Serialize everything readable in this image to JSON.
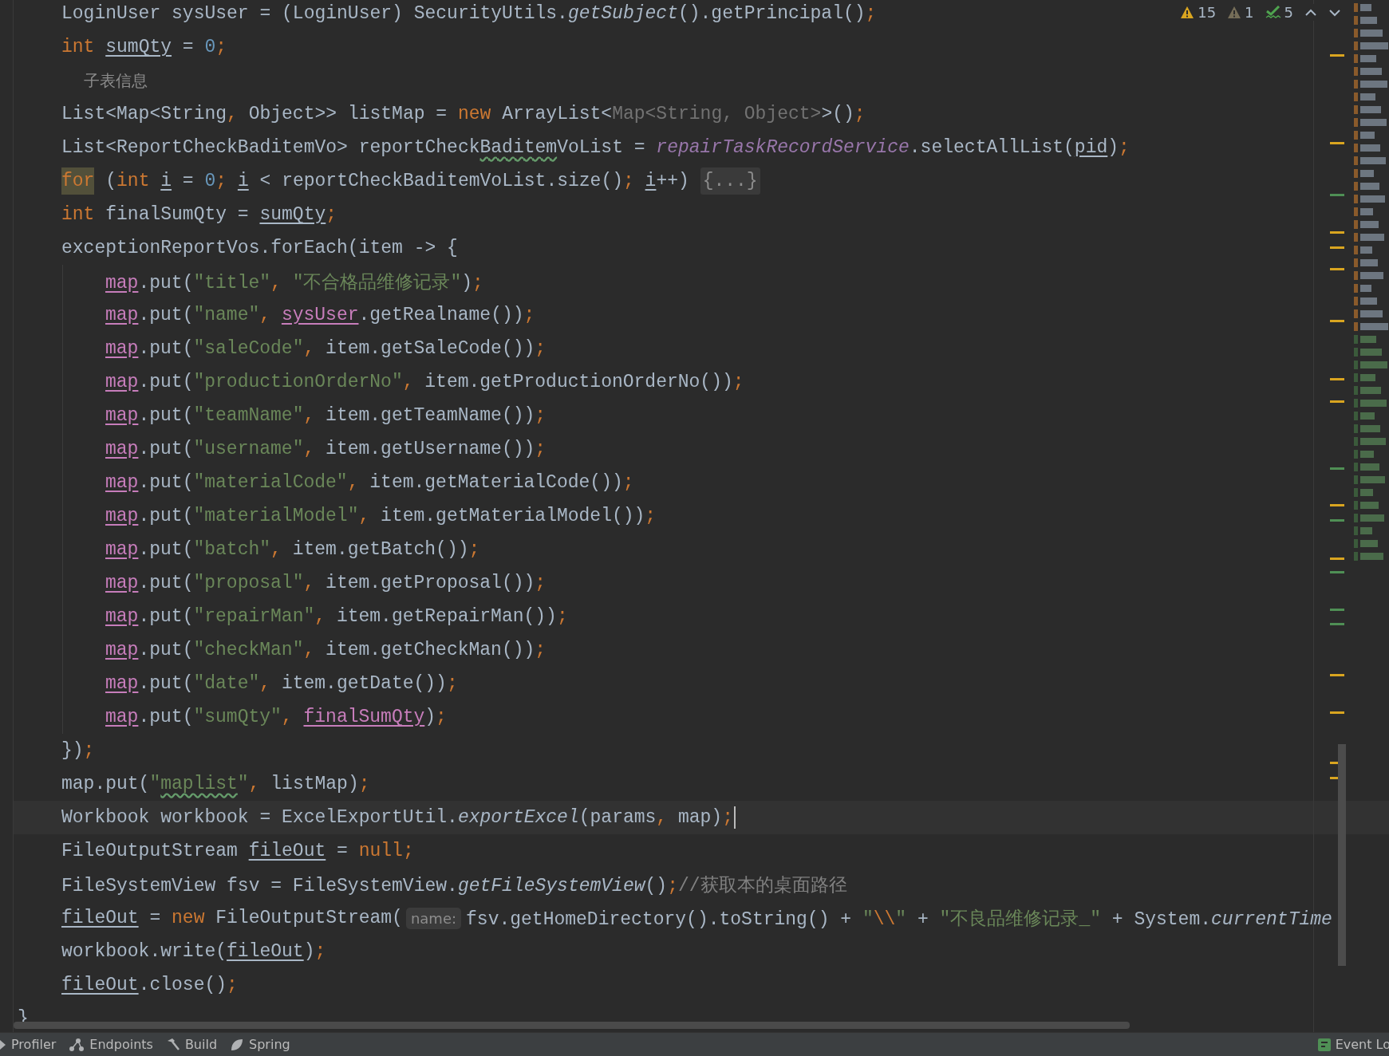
{
  "editor": {
    "inspections": [
      {
        "kind": "warning",
        "count": "15"
      },
      {
        "kind": "weak_warning",
        "count": "1"
      },
      {
        "kind": "typo",
        "count": "5"
      }
    ],
    "body": [
      {
        "current": false,
        "tokens": [
          {
            "kind": "plain",
            "text": "LoginUser sysUser = (LoginUser) SecurityUtils."
          },
          {
            "kind": "italic",
            "text": "getSubject"
          },
          {
            "kind": "plain",
            "text": "().getPrincipal()"
          },
          {
            "kind": "kw",
            "text": ";"
          }
        ]
      },
      {
        "current": false,
        "tokens": [
          {
            "kind": "kw",
            "text": "int "
          },
          {
            "kind": "local",
            "text": "sumQty"
          },
          {
            "kind": "plain",
            "text": " = "
          },
          {
            "kind": "num",
            "text": "0"
          },
          {
            "kind": "kw",
            "text": ";"
          }
        ]
      },
      {
        "current": false,
        "tokens": [
          {
            "kind": "doc",
            "text": "子表信息"
          }
        ]
      },
      {
        "current": false,
        "tokens": [
          {
            "kind": "plain",
            "text": "List<Map<String"
          },
          {
            "kind": "kw",
            "text": ", "
          },
          {
            "kind": "plain",
            "text": "Object>> listMap = "
          },
          {
            "kind": "kw",
            "text": "new "
          },
          {
            "kind": "plain",
            "text": "ArrayList<"
          },
          {
            "kind": "muted",
            "text": "Map<String, Object>"
          },
          {
            "kind": "plain",
            "text": ">()"
          },
          {
            "kind": "kw",
            "text": ";"
          }
        ]
      },
      {
        "current": false,
        "tokens": [
          {
            "kind": "plain",
            "text": "List<ReportCheckBaditemVo> reportCheck"
          },
          {
            "kind": "typo",
            "text": "Baditem"
          },
          {
            "kind": "plain",
            "text": "VoList = "
          },
          {
            "kind": "static",
            "text": "repairTaskRecordService"
          },
          {
            "kind": "plain",
            "text": ".selectAllList("
          },
          {
            "kind": "local",
            "text": "pid"
          },
          {
            "kind": "plain",
            "text": ")"
          },
          {
            "kind": "kw",
            "text": ";"
          }
        ]
      },
      {
        "current": false,
        "tokens": [
          {
            "kind": "mark",
            "text": "for"
          },
          {
            "kind": "plain",
            "text": " ("
          },
          {
            "kind": "kw",
            "text": "int "
          },
          {
            "kind": "local",
            "text": "i"
          },
          {
            "kind": "plain",
            "text": " = "
          },
          {
            "kind": "num",
            "text": "0"
          },
          {
            "kind": "kw",
            "text": "; "
          },
          {
            "kind": "local",
            "text": "i"
          },
          {
            "kind": "plain",
            "text": " < reportCheckBaditemVoList.size()"
          },
          {
            "kind": "kw",
            "text": "; "
          },
          {
            "kind": "local",
            "text": "i"
          },
          {
            "kind": "plain",
            "text": "++) "
          },
          {
            "kind": "fold",
            "text": "{...}"
          }
        ]
      },
      {
        "current": false,
        "tokens": [
          {
            "kind": "kw",
            "text": "int "
          },
          {
            "kind": "plain",
            "text": "finalSumQty = "
          },
          {
            "kind": "local",
            "text": "sumQty"
          },
          {
            "kind": "kw",
            "text": ";"
          }
        ]
      },
      {
        "current": false,
        "tokens": [
          {
            "kind": "plain",
            "text": "exceptionReportVos.forEach(item -> {"
          }
        ],
        "children": [
          {
            "current": false,
            "tokens": [
              {
                "kind": "captured",
                "text": "map"
              },
              {
                "kind": "plain",
                "text": ".put("
              },
              {
                "kind": "str",
                "text": "\"title\""
              },
              {
                "kind": "kw",
                "text": ", "
              },
              {
                "kind": "str",
                "text": "\"不合格品维修记录\""
              },
              {
                "kind": "plain",
                "text": ")"
              },
              {
                "kind": "kw",
                "text": ";"
              }
            ]
          },
          {
            "current": false,
            "tokens": [
              {
                "kind": "captured",
                "text": "map"
              },
              {
                "kind": "plain",
                "text": ".put("
              },
              {
                "kind": "str",
                "text": "\"name\""
              },
              {
                "kind": "kw",
                "text": ", "
              },
              {
                "kind": "captured",
                "text": "sysUser"
              },
              {
                "kind": "plain",
                "text": ".getRealname())"
              },
              {
                "kind": "kw",
                "text": ";"
              }
            ]
          },
          {
            "current": false,
            "tokens": [
              {
                "kind": "captured",
                "text": "map"
              },
              {
                "kind": "plain",
                "text": ".put("
              },
              {
                "kind": "str",
                "text": "\"saleCode\""
              },
              {
                "kind": "kw",
                "text": ", "
              },
              {
                "kind": "plain",
                "text": "item.getSaleCode())"
              },
              {
                "kind": "kw",
                "text": ";"
              }
            ]
          },
          {
            "current": false,
            "tokens": [
              {
                "kind": "captured",
                "text": "map"
              },
              {
                "kind": "plain",
                "text": ".put("
              },
              {
                "kind": "str",
                "text": "\"productionOrderNo\""
              },
              {
                "kind": "kw",
                "text": ", "
              },
              {
                "kind": "plain",
                "text": "item.getProductionOrderNo())"
              },
              {
                "kind": "kw",
                "text": ";"
              }
            ]
          },
          {
            "current": false,
            "tokens": [
              {
                "kind": "captured",
                "text": "map"
              },
              {
                "kind": "plain",
                "text": ".put("
              },
              {
                "kind": "str",
                "text": "\"teamName\""
              },
              {
                "kind": "kw",
                "text": ", "
              },
              {
                "kind": "plain",
                "text": "item.getTeamName())"
              },
              {
                "kind": "kw",
                "text": ";"
              }
            ]
          },
          {
            "current": false,
            "tokens": [
              {
                "kind": "captured",
                "text": "map"
              },
              {
                "kind": "plain",
                "text": ".put("
              },
              {
                "kind": "str",
                "text": "\"username\""
              },
              {
                "kind": "kw",
                "text": ", "
              },
              {
                "kind": "plain",
                "text": "item.getUsername())"
              },
              {
                "kind": "kw",
                "text": ";"
              }
            ]
          },
          {
            "current": false,
            "tokens": [
              {
                "kind": "captured",
                "text": "map"
              },
              {
                "kind": "plain",
                "text": ".put("
              },
              {
                "kind": "str",
                "text": "\"materialCode\""
              },
              {
                "kind": "kw",
                "text": ", "
              },
              {
                "kind": "plain",
                "text": "item.getMaterialCode())"
              },
              {
                "kind": "kw",
                "text": ";"
              }
            ]
          },
          {
            "current": false,
            "tokens": [
              {
                "kind": "captured",
                "text": "map"
              },
              {
                "kind": "plain",
                "text": ".put("
              },
              {
                "kind": "str",
                "text": "\"materialModel\""
              },
              {
                "kind": "kw",
                "text": ", "
              },
              {
                "kind": "plain",
                "text": "item.getMaterialModel())"
              },
              {
                "kind": "kw",
                "text": ";"
              }
            ]
          },
          {
            "current": false,
            "tokens": [
              {
                "kind": "captured",
                "text": "map"
              },
              {
                "kind": "plain",
                "text": ".put("
              },
              {
                "kind": "str",
                "text": "\"batch\""
              },
              {
                "kind": "kw",
                "text": ", "
              },
              {
                "kind": "plain",
                "text": "item.getBatch())"
              },
              {
                "kind": "kw",
                "text": ";"
              }
            ]
          },
          {
            "current": false,
            "tokens": [
              {
                "kind": "captured",
                "text": "map"
              },
              {
                "kind": "plain",
                "text": ".put("
              },
              {
                "kind": "str",
                "text": "\"proposal\""
              },
              {
                "kind": "kw",
                "text": ", "
              },
              {
                "kind": "plain",
                "text": "item.getProposal())"
              },
              {
                "kind": "kw",
                "text": ";"
              }
            ]
          },
          {
            "current": false,
            "tokens": [
              {
                "kind": "captured",
                "text": "map"
              },
              {
                "kind": "plain",
                "text": ".put("
              },
              {
                "kind": "str",
                "text": "\"repairMan\""
              },
              {
                "kind": "kw",
                "text": ", "
              },
              {
                "kind": "plain",
                "text": "item.getRepairMan())"
              },
              {
                "kind": "kw",
                "text": ";"
              }
            ]
          },
          {
            "current": false,
            "tokens": [
              {
                "kind": "captured",
                "text": "map"
              },
              {
                "kind": "plain",
                "text": ".put("
              },
              {
                "kind": "str",
                "text": "\"checkMan\""
              },
              {
                "kind": "kw",
                "text": ", "
              },
              {
                "kind": "plain",
                "text": "item.getCheckMan())"
              },
              {
                "kind": "kw",
                "text": ";"
              }
            ]
          },
          {
            "current": false,
            "tokens": [
              {
                "kind": "captured",
                "text": "map"
              },
              {
                "kind": "plain",
                "text": ".put("
              },
              {
                "kind": "str",
                "text": "\"date\""
              },
              {
                "kind": "kw",
                "text": ", "
              },
              {
                "kind": "plain",
                "text": "item.getDate())"
              },
              {
                "kind": "kw",
                "text": ";"
              }
            ]
          },
          {
            "current": false,
            "tokens": [
              {
                "kind": "captured",
                "text": "map"
              },
              {
                "kind": "plain",
                "text": ".put("
              },
              {
                "kind": "str",
                "text": "\"sumQty\""
              },
              {
                "kind": "kw",
                "text": ", "
              },
              {
                "kind": "captured",
                "text": "finalSumQty"
              },
              {
                "kind": "plain",
                "text": ")"
              },
              {
                "kind": "kw",
                "text": ";"
              }
            ]
          }
        ]
      },
      {
        "current": false,
        "tokens": [
          {
            "kind": "plain",
            "text": "})"
          },
          {
            "kind": "kw",
            "text": ";"
          }
        ]
      },
      {
        "current": false,
        "tokens": [
          {
            "kind": "plain",
            "text": "map.put("
          },
          {
            "kind": "str",
            "text": "\""
          },
          {
            "kind": "strtypo",
            "text": "maplist"
          },
          {
            "kind": "str",
            "text": "\""
          },
          {
            "kind": "kw",
            "text": ", "
          },
          {
            "kind": "plain",
            "text": "listMap)"
          },
          {
            "kind": "kw",
            "text": ";"
          }
        ]
      },
      {
        "current": true,
        "tokens": [
          {
            "kind": "plain",
            "text": "Workbook workbook = ExcelExportUtil."
          },
          {
            "kind": "italic",
            "text": "exportExcel"
          },
          {
            "kind": "plain",
            "text": "(params"
          },
          {
            "kind": "kw",
            "text": ", "
          },
          {
            "kind": "plain",
            "text": "map)"
          },
          {
            "kind": "kw",
            "text": ";"
          }
        ]
      },
      {
        "current": false,
        "tokens": [
          {
            "kind": "plain",
            "text": "FileOutputStream "
          },
          {
            "kind": "local",
            "text": "fileOut"
          },
          {
            "kind": "plain",
            "text": " = "
          },
          {
            "kind": "kw",
            "text": "null"
          },
          {
            "kind": "kw",
            "text": ";"
          }
        ]
      },
      {
        "current": false,
        "tokens": [
          {
            "kind": "plain",
            "text": "FileSystemView fsv = FileSystemView."
          },
          {
            "kind": "italic",
            "text": "getFileSystemView"
          },
          {
            "kind": "plain",
            "text": "()"
          },
          {
            "kind": "kw",
            "text": ";"
          },
          {
            "kind": "comment",
            "text": "//获取本的桌面路径"
          }
        ]
      },
      {
        "current": false,
        "tokens": [
          {
            "kind": "local",
            "text": "fileOut"
          },
          {
            "kind": "plain",
            "text": " = "
          },
          {
            "kind": "kw",
            "text": "new "
          },
          {
            "kind": "plain",
            "text": "FileOutputStream("
          },
          {
            "kind": "hint",
            "text": "name:"
          },
          {
            "kind": "plain",
            "text": "fsv.getHomeDirectory().toString() + "
          },
          {
            "kind": "str",
            "text": "\""
          },
          {
            "kind": "kw",
            "text": "\\\\"
          },
          {
            "kind": "str",
            "text": "\""
          },
          {
            "kind": "plain",
            "text": " + "
          },
          {
            "kind": "str",
            "text": "\"不良品维修记录_\""
          },
          {
            "kind": "plain",
            "text": " + System."
          },
          {
            "kind": "italic",
            "text": "currentTime"
          }
        ]
      },
      {
        "current": false,
        "tokens": [
          {
            "kind": "plain",
            "text": "workbook.write("
          },
          {
            "kind": "local",
            "text": "fileOut"
          },
          {
            "kind": "plain",
            "text": ")"
          },
          {
            "kind": "kw",
            "text": ";"
          }
        ]
      },
      {
        "current": false,
        "tokens": [
          {
            "kind": "local",
            "text": "fileOut"
          },
          {
            "kind": "plain",
            "text": ".close()"
          },
          {
            "kind": "kw",
            "text": ";"
          }
        ]
      }
    ],
    "closing": [
      {
        "current": false,
        "tokens": [
          {
            "kind": "plain",
            "text": "}"
          }
        ]
      }
    ]
  },
  "tool_windows": [
    {
      "kind": "profiler",
      "label": "Profiler"
    },
    {
      "kind": "endpoints",
      "label": "Endpoints"
    },
    {
      "kind": "build",
      "label": "Build"
    },
    {
      "kind": "spring",
      "label": "Spring"
    }
  ],
  "event_log": {
    "label": "Event Lo"
  }
}
